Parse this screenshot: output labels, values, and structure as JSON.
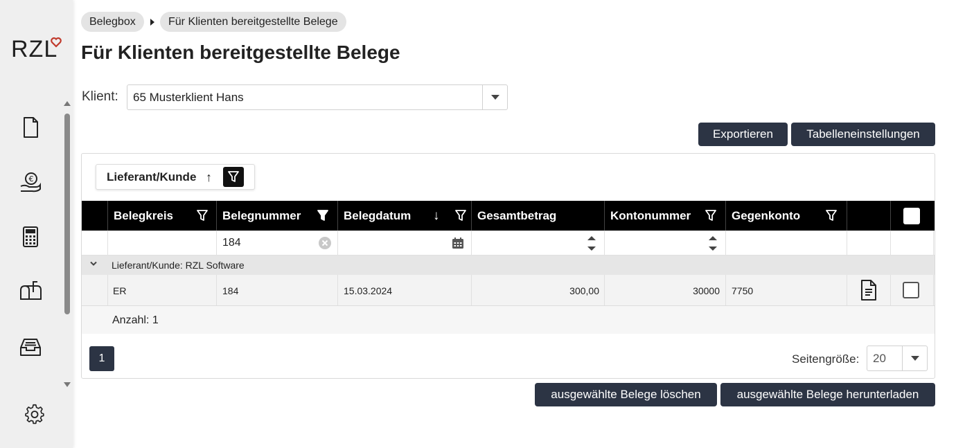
{
  "app": {
    "logo_text": "RZL",
    "accent_color": "#c0392b",
    "dark_color": "#2c3444"
  },
  "sidebar": {
    "items": [
      {
        "icon": "document-icon"
      },
      {
        "icon": "coins-hand-icon"
      },
      {
        "icon": "calculator-icon"
      },
      {
        "icon": "mailbox-icon"
      },
      {
        "icon": "inbox-tray-icon"
      }
    ],
    "settings_icon": "gear-icon"
  },
  "breadcrumb": {
    "items": [
      "Belegbox",
      "Für Klienten bereitgestellte Belege"
    ]
  },
  "page": {
    "title": "Für Klienten bereitgestellte Belege"
  },
  "client": {
    "label": "Klient:",
    "value": "65 Musterklient Hans"
  },
  "toolbar": {
    "export_label": "Exportieren",
    "settings_label": "Tabelleneinstellungen"
  },
  "grouping": {
    "label": "Lieferant/Kunde",
    "sort": "↑"
  },
  "table": {
    "columns": [
      "Belegkreis",
      "Belegnummer",
      "Belegdatum",
      "Gesamtbetrag",
      "Kontonummer",
      "Gegenkonto"
    ],
    "filters": {
      "belegnummer": "184"
    },
    "group_label": "Lieferant/Kunde: RZL Software",
    "rows": [
      {
        "belegkreis": "ER",
        "belegnummer": "184",
        "belegdatum": "15.03.2024",
        "gesamtbetrag": "300,00",
        "kontonummer": "30000",
        "gegenkonto": "7750"
      }
    ],
    "count_label": "Anzahl: 1"
  },
  "pager": {
    "current_page": "1",
    "page_size_label": "Seitengröße:",
    "page_size": "20"
  },
  "actions": {
    "delete_label": "ausgewählte Belege löschen",
    "download_label": "ausgewählte Belege herunterladen"
  }
}
